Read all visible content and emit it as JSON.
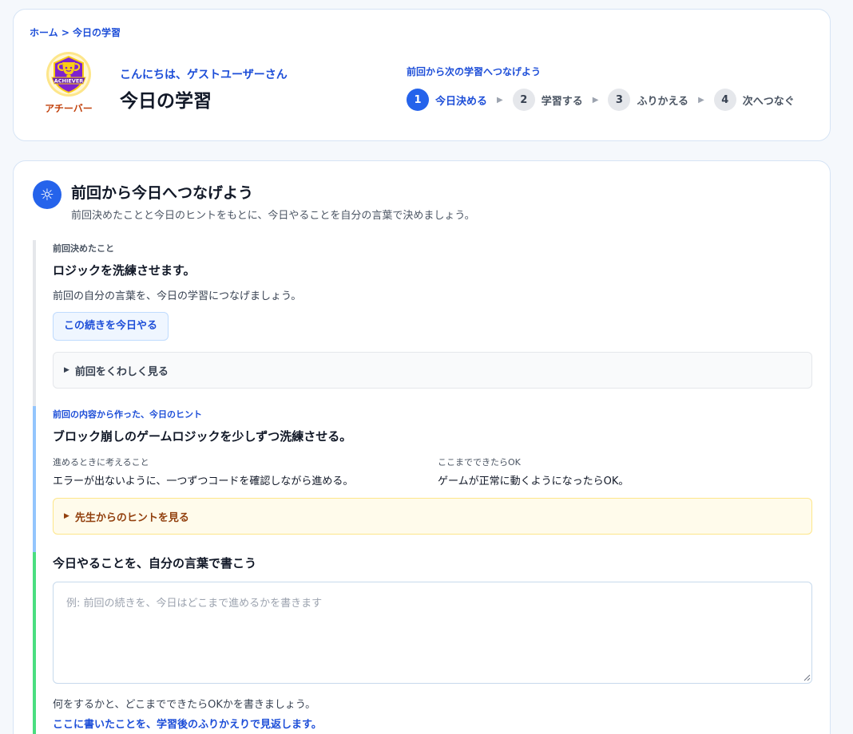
{
  "header": {
    "breadcrumb": "ホーム > 今日の学習",
    "badge": {
      "emblem_text": "ACHIEVER",
      "label": "アチーバー"
    },
    "greeting": "こんにちは、ゲストユーザーさん",
    "title": "今日の学習",
    "steps_caption": "前回から次の学習へつなげよう",
    "steps": [
      {
        "num": "1",
        "label": "今日決める",
        "active": true
      },
      {
        "num": "2",
        "label": "学習する",
        "active": false
      },
      {
        "num": "3",
        "label": "ふりかえる",
        "active": false
      },
      {
        "num": "4",
        "label": "次へつなぐ",
        "active": false
      }
    ]
  },
  "section": {
    "icon": "sun-icon",
    "title": "前回から今日へつなげよう",
    "subtitle": "前回決めたことと今日のヒントをもとに、今日やることを自分の言葉で決めましょう。",
    "previous": {
      "label": "前回決めたこと",
      "goal": "ロジックを洗練させます。",
      "note": "前回の自分の言葉を、今日の学習につなげましょう。",
      "continue_button": "この続きを今日やる",
      "details_toggle": "前回をくわしく見る"
    },
    "hint": {
      "label": "前回の内容から作った、今日のヒント",
      "text": "ブロック崩しのゲームロジックを少しずつ洗練させる。",
      "consider_label": "進めるときに考えること",
      "consider_value": "エラーが出ないように、一つずつコードを確認しながら進める。",
      "ok_label": "ここまでできたらOK",
      "ok_value": "ゲームが正常に動くようになったらOK。",
      "teacher_toggle": "先生からのヒントを見る"
    },
    "today": {
      "heading": "今日やることを、自分の言葉で書こう",
      "value": "",
      "placeholder": "例: 前回の続きを、今日はどこまで進めるかを書きます",
      "help": "何をするかと、どこまでできたらOKかを書きましょう。",
      "note": "ここに書いたことを、学習後のふりかえりで見返します。"
    }
  },
  "colors": {
    "accent": "#2563eb",
    "link": "#1d4ed8",
    "previous_bar": "#e5e7eb",
    "hint_bar": "#93c5fd",
    "today_bar": "#4ade80",
    "hint_box": "#fffbeb"
  }
}
